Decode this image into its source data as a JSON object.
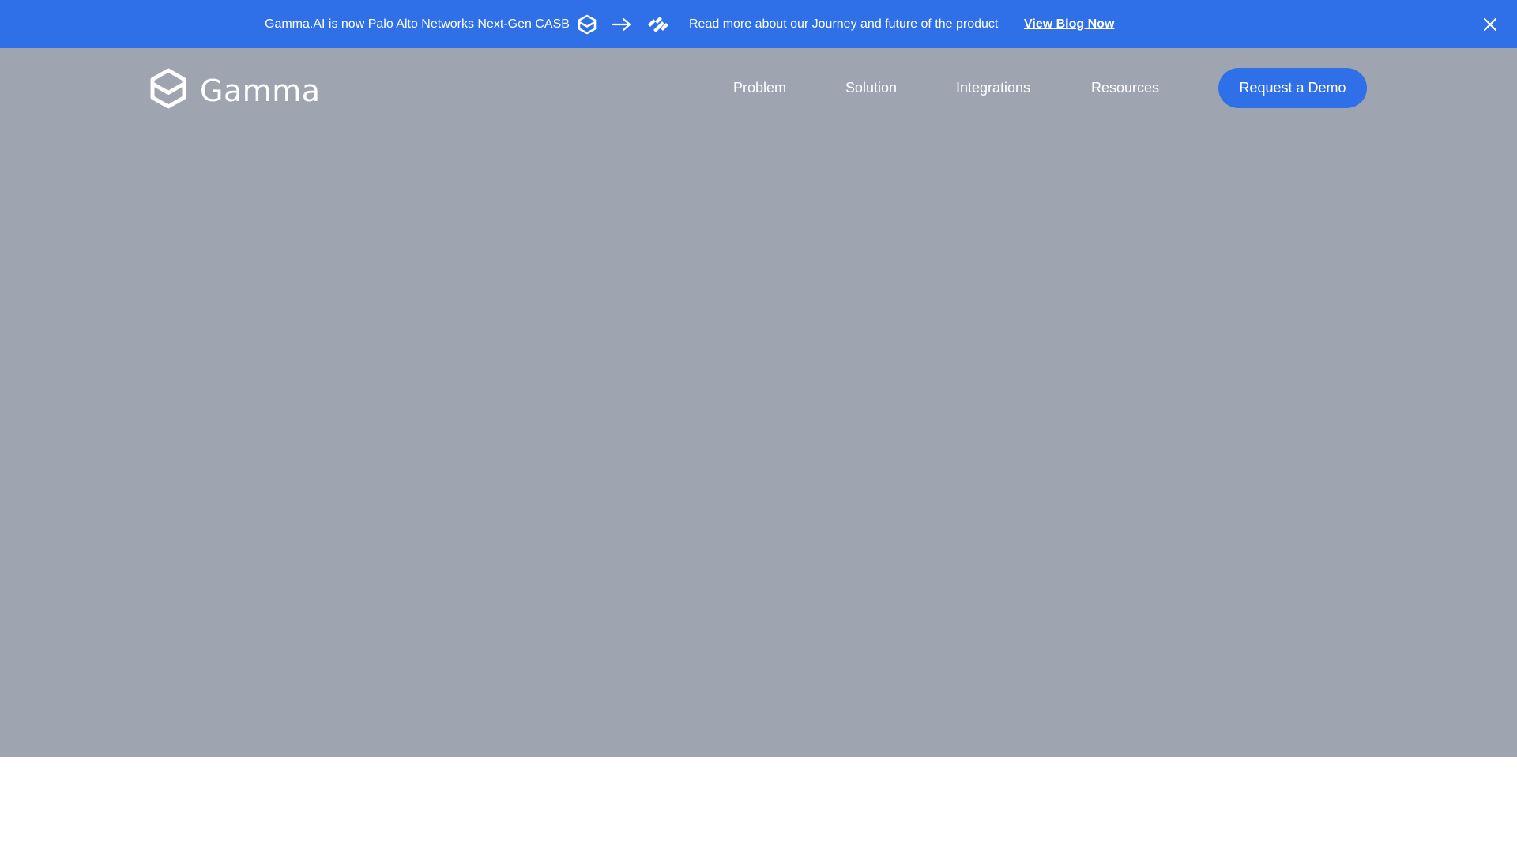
{
  "banner": {
    "announcement": "Gamma.AI is now Palo Alto Networks Next-Gen CASB",
    "icons": [
      "gamma-logo-icon",
      "arrow-right-icon",
      "palo-alto-logo-icon"
    ],
    "read_more": "Read more about our Journey and future of the product",
    "link_label": "View Blog Now",
    "close_icon": "close-icon"
  },
  "header": {
    "logo_text": "Gamma",
    "nav": [
      "Problem",
      "Solution",
      "Integrations",
      "Resources"
    ],
    "cta": "Request a Demo"
  },
  "colors": {
    "accent": "#2f6fe8",
    "hero_overlay": "#9ea5b0",
    "text_on_dark": "#ffffff"
  }
}
